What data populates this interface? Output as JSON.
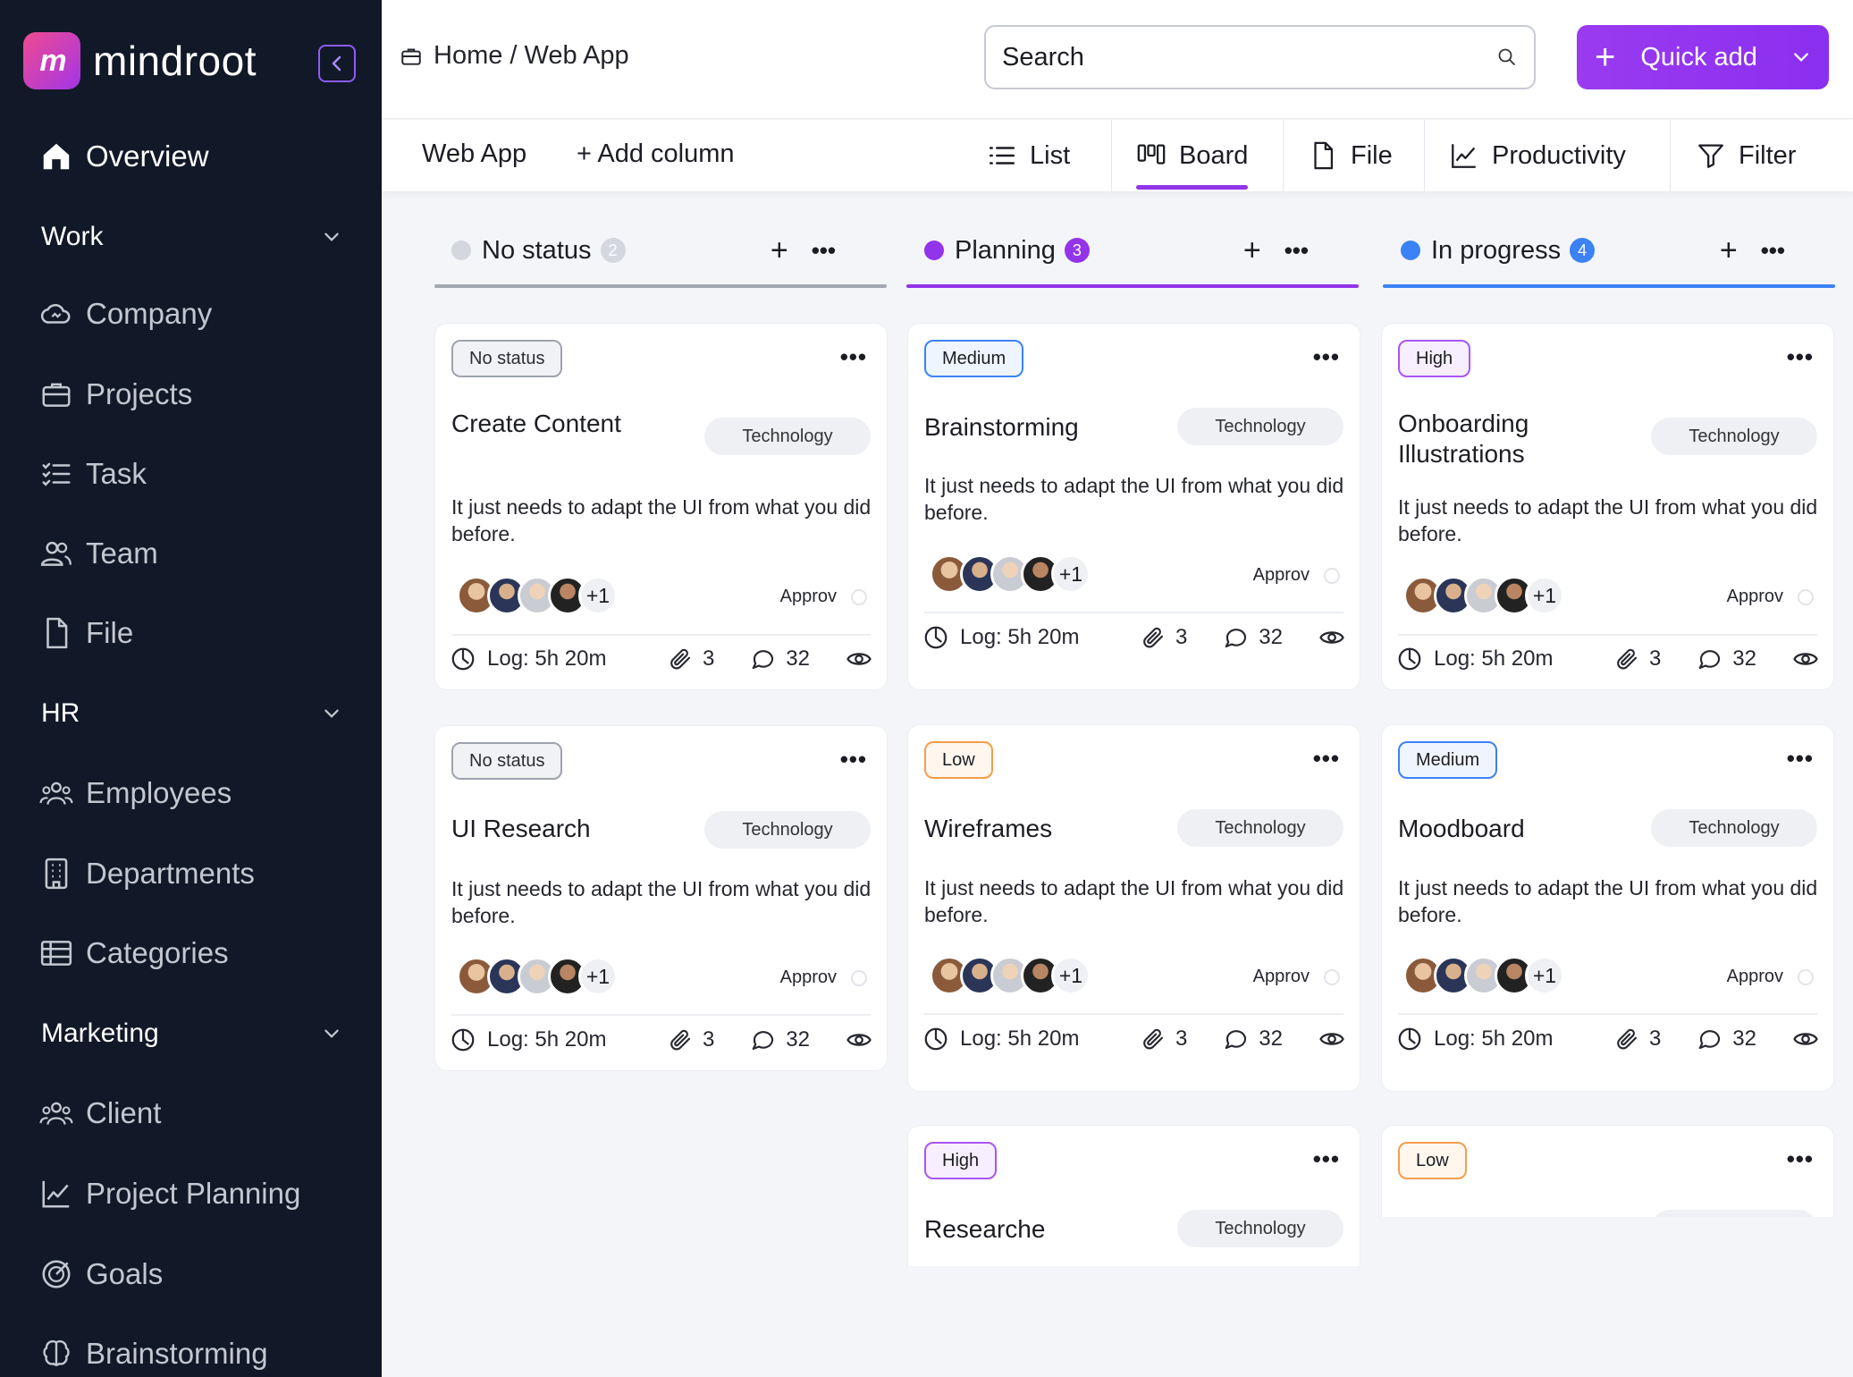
{
  "app": {
    "brand_name": "mindroot",
    "logo_text": "m"
  },
  "sidebar": {
    "overview": "Overview",
    "sections": [
      {
        "label": "Work",
        "items": [
          "Company",
          "Projects",
          "Task",
          "Team",
          "File"
        ]
      },
      {
        "label": "HR",
        "items": [
          "Employees",
          "Departments",
          "Categories"
        ]
      },
      {
        "label": "Marketing",
        "items": [
          "Client",
          "Project Planning",
          "Goals",
          "Brainstorming"
        ]
      }
    ]
  },
  "header": {
    "breadcrumb": "Home / Web App",
    "search_placeholder": "Search",
    "quick_add": "Quick add"
  },
  "subbar": {
    "title": "Web App",
    "add_column": "+ Add column",
    "tabs": [
      "List",
      "Board",
      "File",
      "Productivity",
      "Filter"
    ],
    "active_tab": "Board"
  },
  "colors": {
    "accent": "#9333ea",
    "no_status": "#b8bcc6",
    "planning": "#9333ea",
    "in_progress": "#3b82f6"
  },
  "columns": [
    {
      "name": "No status",
      "count": "2"
    },
    {
      "name": "Planning",
      "count": "3"
    },
    {
      "name": "In progress",
      "count": "4"
    }
  ],
  "cards": [
    {
      "badge": "No status",
      "title": "Create Content",
      "tag": "Technology",
      "desc": "It just needs to adapt the UI from what you did before.",
      "extra": "+1",
      "approv": "Approv",
      "log": "Log: 5h 20m",
      "attachments": "3",
      "comments": "32"
    },
    {
      "badge": "No status",
      "title": "UI Research",
      "tag": "Technology",
      "desc": "It just needs to adapt the UI from what you did before.",
      "extra": "+1",
      "approv": "Approv",
      "log": "Log: 5h 20m",
      "attachments": "3",
      "comments": "32"
    },
    {
      "badge": "Medium",
      "title": "Brainstorming",
      "tag": "Technology",
      "desc": "It just needs to adapt the UI from what you did before.",
      "extra": "+1",
      "approv": "Approv",
      "log": "Log: 5h 20m",
      "attachments": "3",
      "comments": "32"
    },
    {
      "badge": "Low",
      "title": "Wireframes",
      "tag": "Technology",
      "desc": "It just needs to adapt the UI from what you did before.",
      "extra": "+1",
      "approv": "Approv",
      "log": "Log: 5h 20m",
      "attachments": "3",
      "comments": "32"
    },
    {
      "badge": "High",
      "title": "Researche",
      "tag": "Technology"
    },
    {
      "badge": "High",
      "title": "Onboarding Illustrations",
      "tag": "Technology",
      "desc": "It just needs to adapt the UI from what you did before.",
      "extra": "+1",
      "approv": "Approv",
      "log": "Log: 5h 20m",
      "attachments": "3",
      "comments": "32"
    },
    {
      "badge": "Medium",
      "title": "Moodboard",
      "tag": "Technology",
      "desc": "It just needs to adapt the UI from what you did before.",
      "extra": "+1",
      "approv": "Approv",
      "log": "Log: 5h 20m",
      "attachments": "3",
      "comments": "32"
    },
    {
      "badge": "Low"
    }
  ]
}
